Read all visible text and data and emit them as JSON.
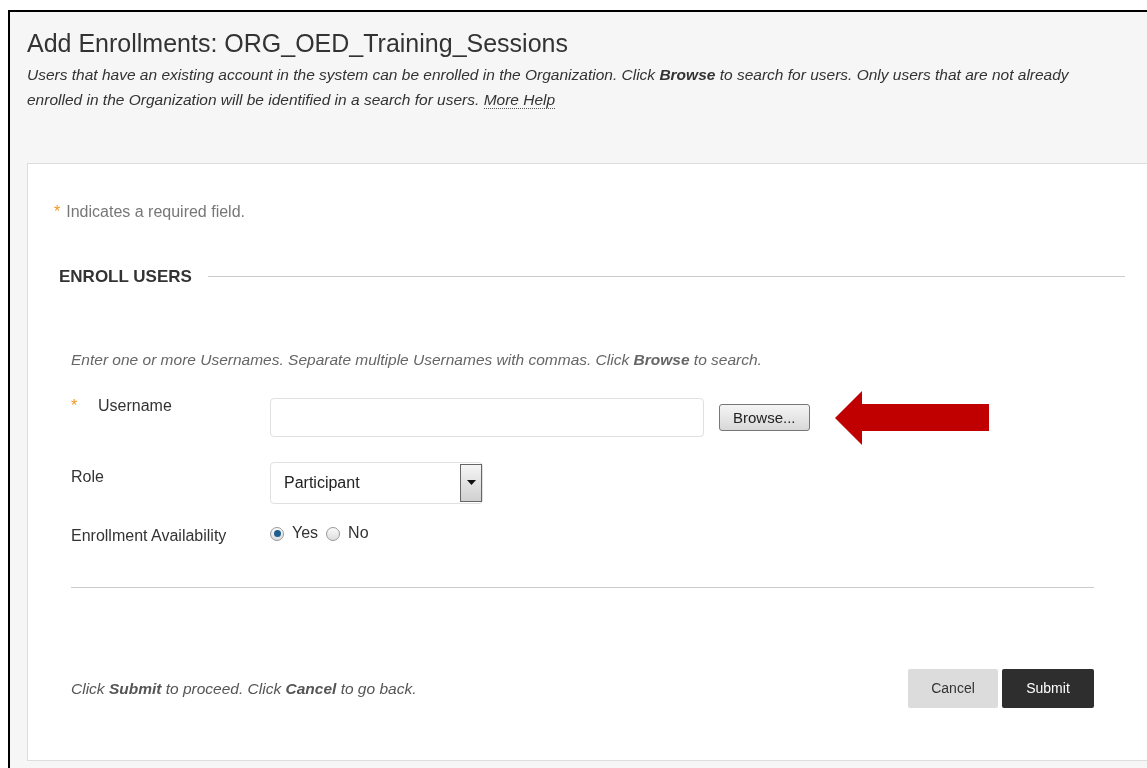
{
  "header": {
    "title": "Add Enrollments: ORG_OED_Training_Sessions",
    "description": "Users that have an existing account in the system can be enrolled in the Organization. Click **Browse** to search for users. Only users that are not already enrolled in the Organization will be identified in a search for users.",
    "help_link": "More Help"
  },
  "required_note": {
    "marker": "*",
    "text": "Indicates a required field."
  },
  "section": {
    "title": "ENROLL USERS",
    "instructions": "Enter one or more Usernames. Separate multiple Usernames with commas. Click **Browse** to search.",
    "fields": [
      {
        "kind": "text",
        "label": "Username",
        "required": true,
        "marker": "*",
        "button": "Browse..."
      },
      {
        "kind": "select",
        "label": "Role",
        "required": false,
        "value": "Participant"
      },
      {
        "kind": "radio",
        "label": "Enrollment Availability",
        "required": false,
        "options": [
          {
            "label": "Yes",
            "selected": true
          },
          {
            "label": "No",
            "selected": false
          }
        ]
      }
    ]
  },
  "footer": {
    "hint": "Click **Submit** to proceed. Click **Cancel** to go back.",
    "buttons": [
      {
        "label": "Cancel",
        "kind": "secondary"
      },
      {
        "label": "Submit",
        "kind": "primary"
      }
    ]
  }
}
